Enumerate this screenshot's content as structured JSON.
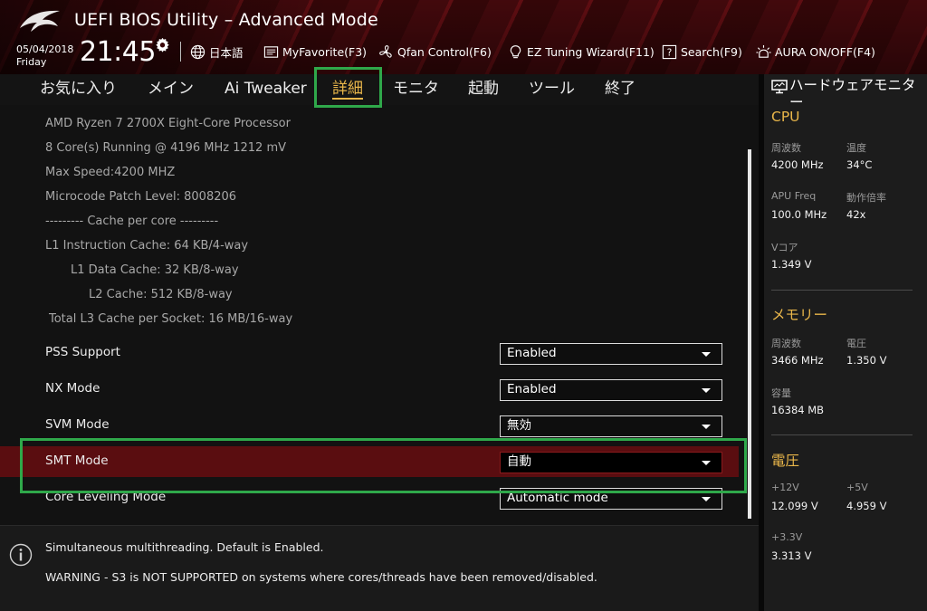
{
  "header": {
    "title": "UEFI BIOS Utility – Advanced Mode",
    "date": "05/04/2018",
    "day": "Friday",
    "time": "21:45",
    "toolbar": [
      {
        "label": "日本語",
        "icon": "globe-icon"
      },
      {
        "label": "MyFavorite(F3)",
        "icon": "favorite-icon"
      },
      {
        "label": "Qfan Control(F6)",
        "icon": "fan-icon"
      },
      {
        "label": "EZ Tuning Wizard(F11)",
        "icon": "bulb-icon"
      },
      {
        "label": "Search(F9)",
        "icon": "search-icon"
      },
      {
        "label": "AURA ON/OFF(F4)",
        "icon": "aura-icon"
      }
    ]
  },
  "tabs": [
    {
      "label": "お気に入り"
    },
    {
      "label": "メイン"
    },
    {
      "label": "Ai Tweaker"
    },
    {
      "label": "詳細",
      "active": true
    },
    {
      "label": "モニタ"
    },
    {
      "label": "起動"
    },
    {
      "label": "ツール"
    },
    {
      "label": "終了"
    }
  ],
  "cpu_info": [
    "AMD Ryzen 7 2700X Eight-Core Processor",
    "8 Core(s) Running @ 4196 MHz  1212 mV",
    "Max Speed:4200 MHZ",
    "Microcode Patch Level: 8008206",
    "--------- Cache per core ---------",
    "L1 Instruction Cache: 64 KB/4-way",
    "L1 Data Cache: 32 KB/8-way",
    "L2 Cache: 512 KB/8-way",
    "Total L3 Cache per Socket: 16 MB/16-way"
  ],
  "settings": [
    {
      "label": "PSS Support",
      "value": "Enabled"
    },
    {
      "label": "NX Mode",
      "value": "Enabled"
    },
    {
      "label": "SVM Mode",
      "value": "無効"
    },
    {
      "label": "SMT Mode",
      "value": "自動",
      "selected": true
    },
    {
      "label": "Core Leveling Mode",
      "value": "Automatic mode"
    }
  ],
  "help": {
    "line1": "Simultaneous multithreading. Default is Enabled.",
    "line2": "WARNING - S3 is NOT SUPPORTED on systems where cores/threads have been removed/disabled."
  },
  "hw_monitor": {
    "title": "ハードウェアモニター",
    "cpu": {
      "title": "CPU",
      "freq_label": "周波数",
      "freq_value": "4200 MHz",
      "temp_label": "温度",
      "temp_value": "34°C",
      "apu_label": "APU Freq",
      "apu_value": "100.0 MHz",
      "ratio_label": "動作倍率",
      "ratio_value": "42x",
      "vcore_label": "Vコア",
      "vcore_value": "1.349 V"
    },
    "memory": {
      "title": "メモリー",
      "freq_label": "周波数",
      "freq_value": "3466 MHz",
      "volt_label": "電圧",
      "volt_value": "1.350 V",
      "cap_label": "容量",
      "cap_value": "16384 MB"
    },
    "voltage": {
      "title": "電圧",
      "v12_label": "+12V",
      "v12_value": "12.099 V",
      "v5_label": "+5V",
      "v5_value": "4.959 V",
      "v33_label": "+3.3V",
      "v33_value": "3.313 V"
    }
  },
  "colors": {
    "accent": "#e9b64a",
    "highlight_row": "#5a0d10",
    "focus_box": "#2fa84a"
  }
}
